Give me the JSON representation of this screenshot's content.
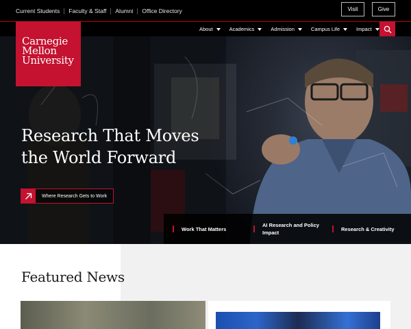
{
  "utility": {
    "links": [
      "Current Students",
      "Faculty & Staff",
      "Alumni",
      "Office Directory"
    ],
    "visit_label": "Visit",
    "give_label": "Give"
  },
  "logo": {
    "lines": [
      "Carnegie",
      "Mellon",
      "University"
    ]
  },
  "nav": {
    "items": [
      "About",
      "Academics",
      "Admission",
      "Campus Life",
      "Impact"
    ]
  },
  "hero": {
    "headline_line1": "Research That Moves",
    "headline_line2": "the World Forward",
    "cta_label": "Where Research Gets to Work",
    "strip": [
      "Work That Matters",
      "AI Research and Policy Impact",
      "Research & Creativity"
    ]
  },
  "featured": {
    "title": "Featured News"
  },
  "colors": {
    "brand_red": "#c41230",
    "nav_black": "#000000"
  },
  "icons": {
    "search": "search-icon",
    "cta": "arrow-up-right-icon"
  }
}
